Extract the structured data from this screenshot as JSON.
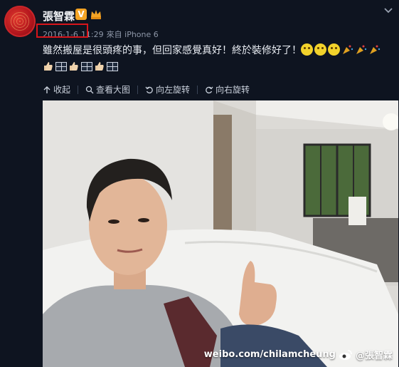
{
  "post": {
    "username": "張智霖",
    "verified_badge": "V",
    "date": "2016-1-6",
    "time": "11:29",
    "source": "來自 iPhone 6",
    "text": "雖然搬屋是很頭疼的事，但回家感覺真好！終於裝修好了！"
  },
  "toolbar": {
    "collapse": "收起",
    "view_large": "查看大图",
    "rotate_left": "向左旋转",
    "rotate_right": "向右旋转"
  },
  "photo": {
    "watermark_site": "weibo.com/chilamcheung",
    "watermark_user": "@張智霖"
  },
  "icons": {
    "avatar": "avatar-icon",
    "chevron": "chevron-down-icon",
    "collapse": "collapse-up-icon",
    "view": "magnify-icon",
    "rotate_left": "rotate-left-icon",
    "rotate_right": "rotate-right-icon"
  },
  "colors": {
    "background": "#0e1420",
    "highlight": "#d8151b",
    "badge": "#f4a425"
  }
}
